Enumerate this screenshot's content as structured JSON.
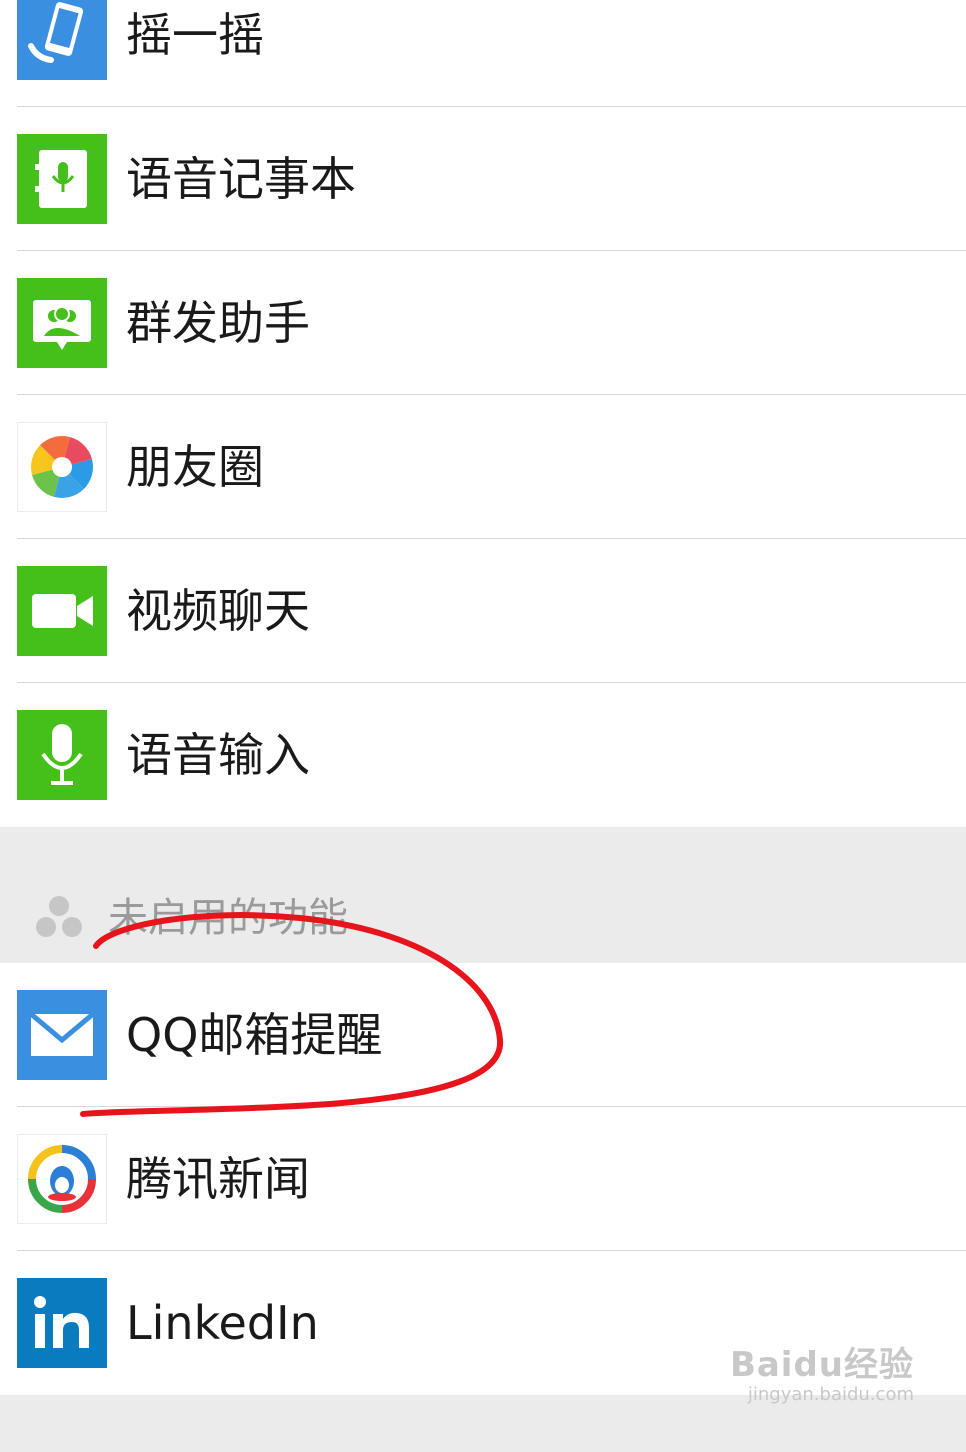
{
  "enabled_features": [
    {
      "label": "摇一摇",
      "icon": "shake-phone-icon"
    },
    {
      "label": "语音记事本",
      "icon": "voice-notepad-icon"
    },
    {
      "label": "群发助手",
      "icon": "broadcast-assistant-icon"
    },
    {
      "label": "朋友圈",
      "icon": "moments-aperture-icon"
    },
    {
      "label": "视频聊天",
      "icon": "video-camera-icon"
    },
    {
      "label": "语音输入",
      "icon": "microphone-icon"
    }
  ],
  "disabled_section": {
    "title": "未启用的功能",
    "icon": "group-dots-icon"
  },
  "disabled_features": [
    {
      "label": "QQ邮箱提醒",
      "icon": "mail-envelope-icon"
    },
    {
      "label": "腾讯新闻",
      "icon": "tencent-news-icon"
    },
    {
      "label": "LinkedIn",
      "icon": "linkedin-icon"
    }
  ],
  "watermark": {
    "logo": "Baidu经验",
    "url": "jingyan.baidu.com"
  },
  "colors": {
    "wechat_green": "#45c01a",
    "mail_blue": "#3b8fe0",
    "linkedin_blue": "#0b7bc0",
    "annotation_red": "#e8141c",
    "section_bg": "#ebebeb"
  }
}
